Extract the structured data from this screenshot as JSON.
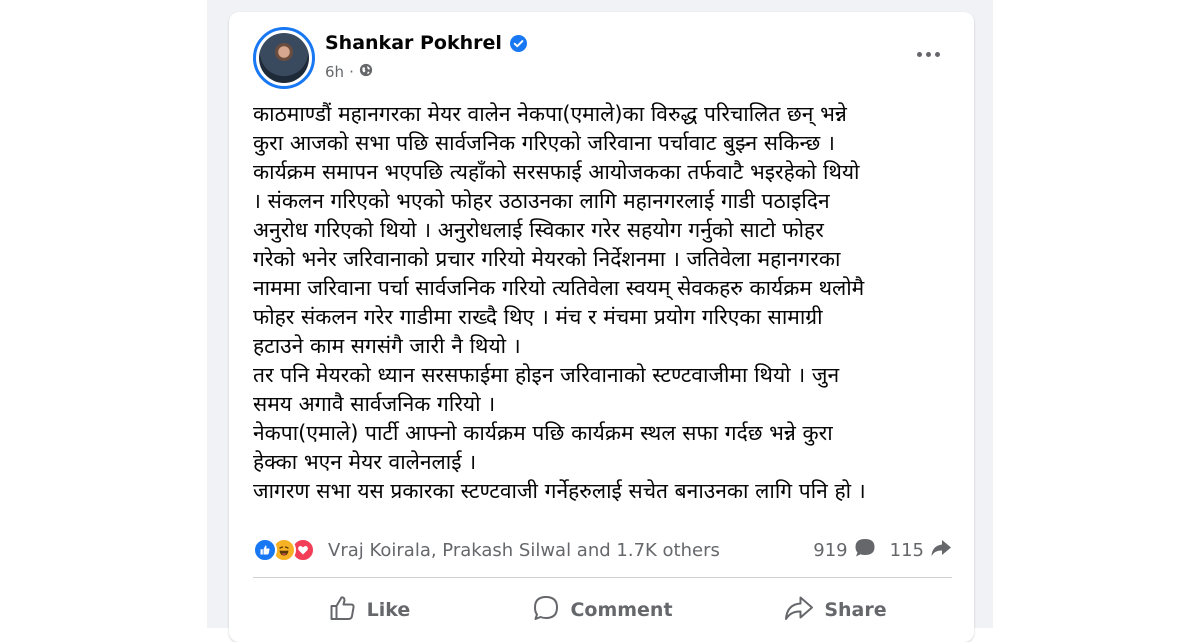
{
  "post": {
    "author": "Shankar Pokhrel",
    "time": "6h",
    "text_lines": [
      "काठमाण्डौं महानगरका मेयर वालेन नेकपा(एमाले)का विरुद्ध परिचालित छन् भन्ने",
      "कुरा आजको सभा पछि सार्वजनिक गरिएको जरिवाना पर्चावाट बुझ्न सकिन्छ ।",
      "कार्यक्रम समापन भएपछि त्यहाँको सरसफाई आयोजकका तर्फवाटै भइरहेको थियो",
      "। संकलन गरिएको भएको फोहर उठाउनका लागि महानगरलाई गाडी पठाइदिन",
      "अनुरोध गरिएको थियो । अनुरोधलाई स्विकार गरेर सहयोग गर्नुको साटो फोहर",
      "गरेको भनेर जरिवानाको प्रचार गरियो मेयरको निर्देशनमा । जतिवेला महानगरका",
      "नाममा जरिवाना पर्चा सार्वजनिक गरियो त्यतिवेला स्वयम् सेवकहरु कार्यक्रम थलोमै",
      "फोहर संकलन गरेर गाडीमा राख्दै थिए । मंच र मंचमा प्रयोग गरिएका सामाग्री",
      "हटाउने काम सगसंगै जारी नै थियो ।",
      "तर पनि मेयरको ध्यान सरसफाईमा होइन जरिवानाको स्टण्टवाजीमा थियो । जुन",
      "समय अगावै सार्वजनिक गरियो ।",
      "नेकपा(एमाले) पार्टी आफ्नो कार्यक्रम पछि कार्यक्रम स्थल सफा गर्दछ भन्ने कुरा",
      "हेक्का भएन मेयर वालेनलाई ।",
      "जागरण सभा यस प्रकारका स्टण्टवाजी गर्नेहरुलाई सचेत बनाउनका लागि पनि हो ।"
    ],
    "reactions_text": "Vraj Koirala, Prakash Silwal and 1.7K others",
    "comment_count": "919",
    "share_count": "115",
    "reaction_icons": [
      "like-icon",
      "haha-icon",
      "love-icon"
    ]
  },
  "actions": {
    "like_label": "Like",
    "comment_label": "Comment",
    "share_label": "Share"
  },
  "colors": {
    "accent": "#1877f2",
    "text": "#050505",
    "secondary_text": "#65676b",
    "feed_background": "#f0f2f5"
  }
}
